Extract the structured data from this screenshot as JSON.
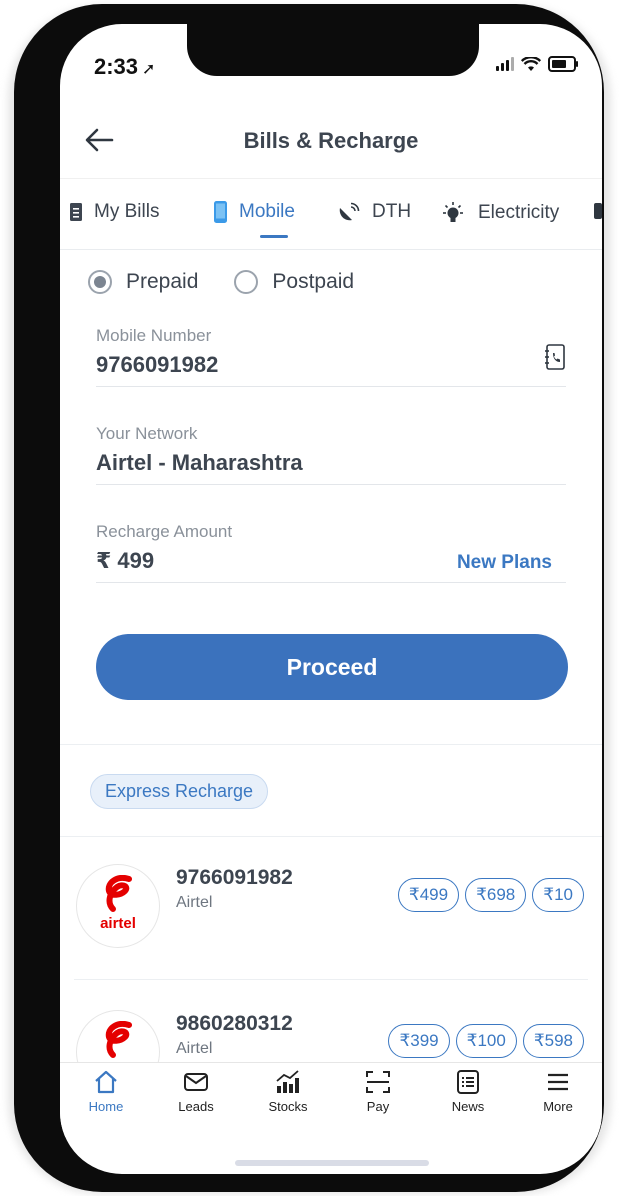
{
  "status_bar": {
    "time": "2:33"
  },
  "header": {
    "title": "Bills & Recharge"
  },
  "tabs": [
    {
      "label": "My Bills",
      "icon": "bill-icon"
    },
    {
      "label": "Mobile",
      "icon": "mobile-icon",
      "active": true
    },
    {
      "label": "DTH",
      "icon": "satellite-dish-icon"
    },
    {
      "label": "Electricity",
      "icon": "bulb-icon"
    }
  ],
  "plan_type": {
    "prepaid_label": "Prepaid",
    "postpaid_label": "Postpaid",
    "selected": "Prepaid"
  },
  "form": {
    "mobile_label": "Mobile Number",
    "mobile_value": "9766091982",
    "network_label": "Your Network",
    "network_value": "Airtel - Maharashtra",
    "amount_label": "Recharge Amount",
    "amount_value": "₹ 499",
    "new_plans_label": "New Plans"
  },
  "proceed_label": "Proceed",
  "express": {
    "label": "Express Recharge",
    "items": [
      {
        "logo_text": "airtel",
        "number": "9766091982",
        "network": "Airtel",
        "amounts": [
          "₹499",
          "₹698",
          "₹10"
        ]
      },
      {
        "logo_text": "airtel",
        "number": "9860280312",
        "network": "Airtel",
        "amounts": [
          "₹399",
          "₹100",
          "₹598"
        ]
      }
    ]
  },
  "bottom_nav": [
    {
      "label": "Home",
      "icon": "home-icon",
      "active": true
    },
    {
      "label": "Leads",
      "icon": "mail-icon"
    },
    {
      "label": "Stocks",
      "icon": "stocks-chart-icon"
    },
    {
      "label": "Pay",
      "icon": "scan-icon"
    },
    {
      "label": "News",
      "icon": "news-icon"
    },
    {
      "label": "More",
      "icon": "menu-icon"
    }
  ],
  "colors": {
    "accent": "#3b78c2",
    "button": "#3b72bd",
    "text": "#3d4550",
    "airtel_red": "#e40000"
  }
}
